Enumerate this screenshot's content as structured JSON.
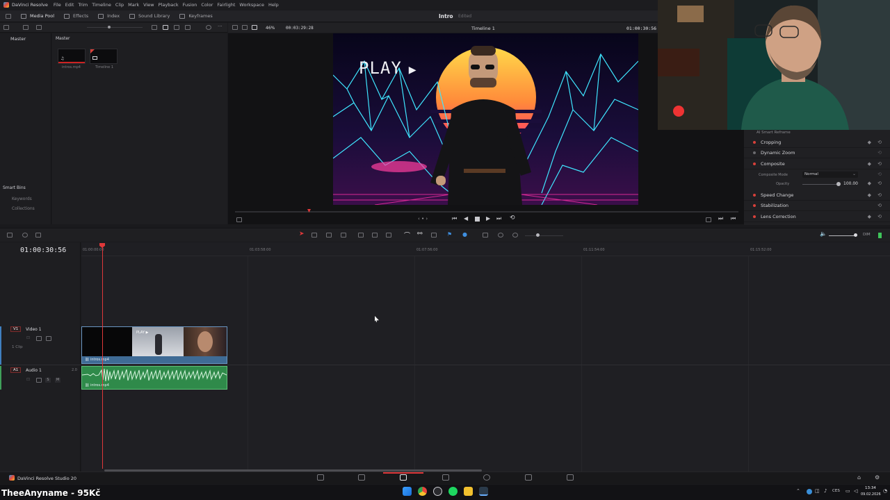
{
  "app": {
    "name": "DaVinci Resolve",
    "menu": [
      "File",
      "Edit",
      "Trim",
      "Timeline",
      "Clip",
      "Mark",
      "View",
      "Playback",
      "Fusion",
      "Color",
      "Fairlight",
      "Workspace",
      "Help"
    ]
  },
  "toolbar": {
    "items": [
      {
        "label": "Media Pool",
        "icon": "media-pool-icon",
        "active": true
      },
      {
        "label": "Effects",
        "icon": "effects-icon",
        "active": false
      },
      {
        "label": "Index",
        "icon": "index-icon",
        "active": false
      },
      {
        "label": "Sound Library",
        "icon": "sound-library-icon",
        "active": false
      },
      {
        "label": "Keyframes",
        "icon": "keyframes-icon",
        "active": false
      }
    ],
    "project_title": "Intro",
    "project_status": "Edited"
  },
  "media_pool": {
    "header_left": "Master",
    "header_right": "Master",
    "bins_title": "Master",
    "clips": [
      {
        "name": "intros.mp4",
        "type": "audio-video"
      },
      {
        "name": "Timeline 1",
        "type": "timeline"
      }
    ],
    "smart_bins_title": "Smart Bins",
    "smart_bins": [
      "Keywords",
      "Collections"
    ]
  },
  "viewer": {
    "zoom": "46%",
    "source_timecode": "00:03:29:28",
    "timeline_name": "Timeline 1",
    "record_timecode": "01:00:30:56",
    "overlay_text": "PLAY"
  },
  "inspector": {
    "sections": [
      {
        "label": "AI Smart Reframe",
        "dot": "none"
      },
      {
        "label": "Cropping",
        "dot": "on"
      },
      {
        "label": "Dynamic Zoom",
        "dot": "off"
      },
      {
        "label": "Composite",
        "dot": "on"
      },
      {
        "label": "Speed Change",
        "dot": "on"
      },
      {
        "label": "Stabilization",
        "dot": "on"
      },
      {
        "label": "Lens Correction",
        "dot": "on"
      }
    ],
    "composite_mode_label": "Composite Mode",
    "composite_mode_value": "Normal",
    "opacity_label": "Opacity",
    "opacity_value": "100.00"
  },
  "timeline": {
    "timecode": "01:00:30:56",
    "ruler_ticks": [
      "01:00:00:00",
      "01:03:58:00",
      "01:07:56:00",
      "01:11:54:00",
      "01:15:52:00"
    ],
    "dim_label": "DIM",
    "tracks": [
      {
        "badge": "V1",
        "name": "Video 1",
        "sub": "1 Clip",
        "clip": "intros.mp4"
      },
      {
        "badge": "A1",
        "name": "Audio 1",
        "level": "2.0",
        "clip": "intros.mp4"
      }
    ]
  },
  "pagebar": {
    "product": "DaVinci Resolve Studio 20",
    "pages": [
      "media-page-icon",
      "cut-page-icon",
      "edit-page-icon",
      "fusion-page-icon",
      "color-page-icon",
      "fairlight-page-icon",
      "deliver-page-icon"
    ],
    "active_page": "edit-page-icon"
  },
  "stream_overlay": {
    "text": "TheeAnyname - 95Kč"
  },
  "taskbar": {
    "language": "CES",
    "time": "13:34",
    "date": "09.02.2026"
  },
  "colors": {
    "accent_red": "#e0383a",
    "video_clip": "#3f6b95",
    "audio_clip": "#2f8a4a"
  }
}
